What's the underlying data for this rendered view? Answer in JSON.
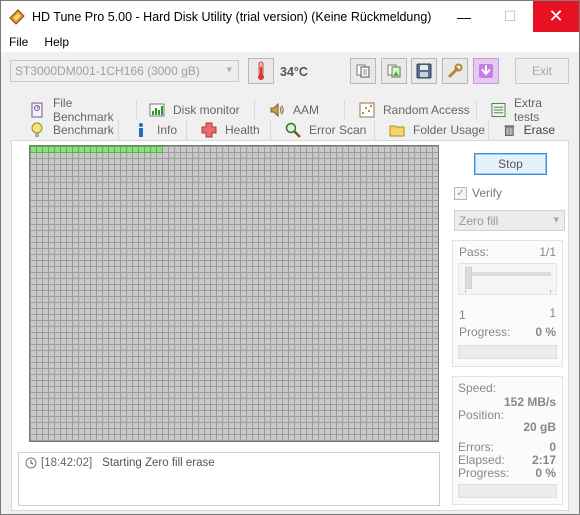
{
  "window": {
    "title": "HD Tune Pro 5.00 - Hard Disk Utility (trial version) (Keine Rückmeldung)",
    "minimize": "—",
    "maximize": "☐",
    "close": "✕"
  },
  "menu": {
    "file": "File",
    "help": "Help"
  },
  "toolbar": {
    "drive": "ST3000DM001-1CH166 (3000 gB)",
    "temperature": "34°C",
    "exit_label": "Exit"
  },
  "tabs": {
    "row1": [
      {
        "label": "File Benchmark",
        "icon": "file-benchmark-icon"
      },
      {
        "label": "Disk monitor",
        "icon": "disk-monitor-icon"
      },
      {
        "label": "AAM",
        "icon": "speaker-icon"
      },
      {
        "label": "Random Access",
        "icon": "random-access-icon"
      },
      {
        "label": "Extra tests",
        "icon": "extra-tests-icon"
      }
    ],
    "row2": [
      {
        "label": "Benchmark",
        "icon": "benchmark-icon"
      },
      {
        "label": "Info",
        "icon": "info-icon"
      },
      {
        "label": "Health",
        "icon": "health-cross-icon"
      },
      {
        "label": "Error Scan",
        "icon": "magnifier-icon"
      },
      {
        "label": "Folder Usage",
        "icon": "folder-icon"
      },
      {
        "label": "Erase",
        "icon": "trash-icon"
      }
    ],
    "active": "Erase"
  },
  "erase": {
    "grid_progress_fraction": 0.33,
    "log": {
      "time": "[18:42:02]",
      "message": "Starting Zero fill erase"
    },
    "stop_label": "Stop",
    "verify_label": "Verify",
    "verify_checked": true,
    "method": "Zero fill",
    "pass": {
      "label": "Pass:",
      "value": "1/1",
      "min": "1",
      "max": "1",
      "progress_label": "Progress:",
      "progress_value": "0 %",
      "progress": 0
    },
    "stats": {
      "speed_label": "Speed:",
      "speed_value": "152 MB/s",
      "position_label": "Position:",
      "position_value": "20 gB",
      "errors_label": "Errors:",
      "errors_value": "0",
      "elapsed_label": "Elapsed:",
      "elapsed_value": "2:17",
      "progress_label": "Progress:",
      "progress_value": "0 %",
      "progress": 0
    }
  },
  "colors": {
    "progress_green": "#8ae07e",
    "block_gray": "#c9c9c9",
    "close_red": "#e81123",
    "accent_blue": "#3c8fd8"
  }
}
